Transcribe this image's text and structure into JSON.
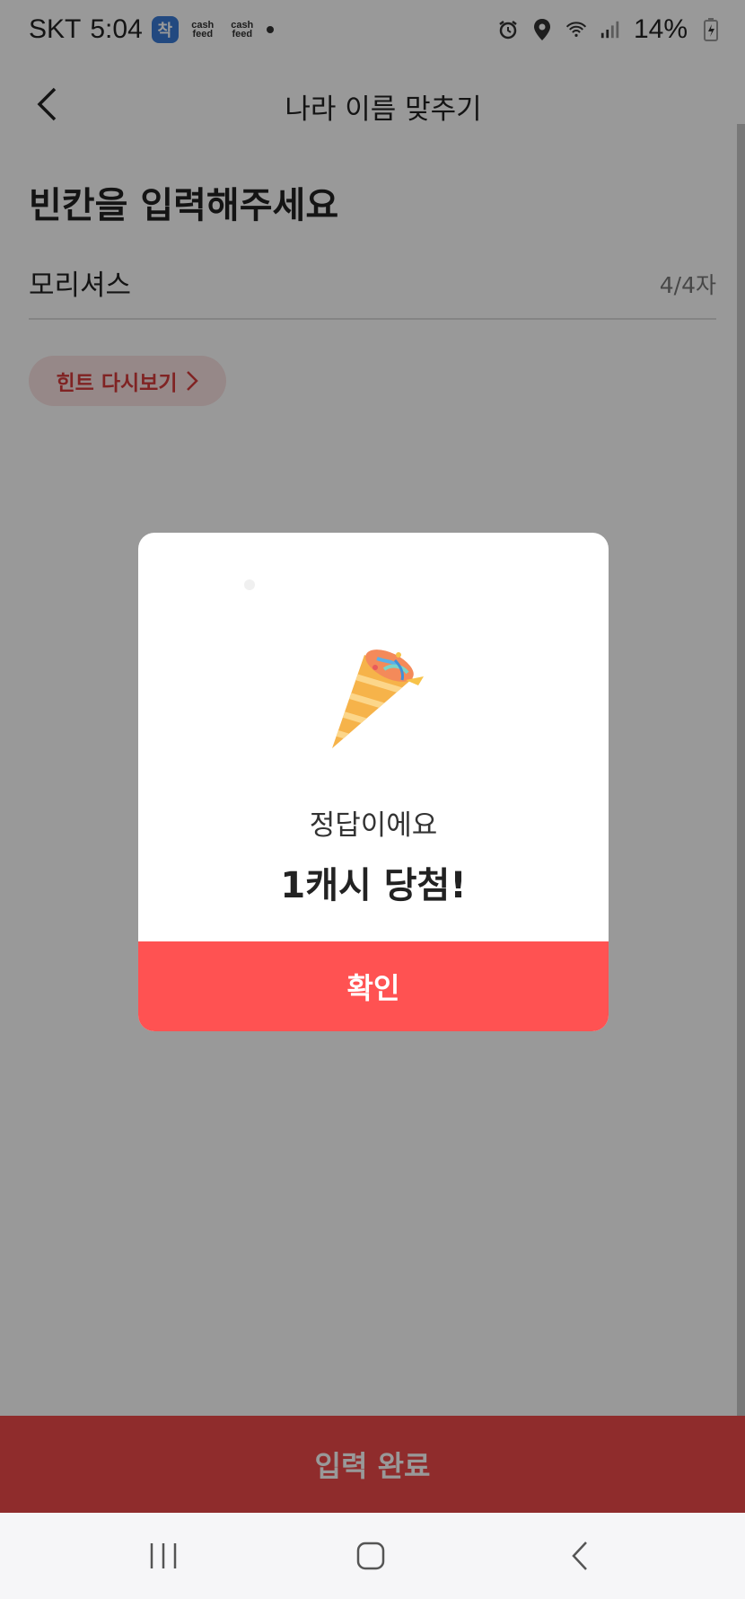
{
  "status_bar": {
    "carrier": "SKT",
    "time": "5:04",
    "app_badge": "착",
    "cashfeed1": "cash feed",
    "cashfeed2": "cash feed",
    "battery": "14%"
  },
  "header": {
    "title": "나라 이름 맞추기",
    "back_icon": "chevron-left-icon"
  },
  "main": {
    "title": "빈칸을 입력해주세요",
    "answer_value": "모리셔스",
    "answer_count": "4/4자",
    "hint_label": "힌트 다시보기"
  },
  "bottom": {
    "submit_label": "입력 완료"
  },
  "modal": {
    "sub_text": "정답이에요",
    "main_text": "1캐시 당첨!",
    "confirm_label": "확인",
    "icon": "party-popper-icon"
  },
  "colors": {
    "accent": "#ff5252",
    "hint_bg": "#fbe3e3",
    "hint_text": "#d63b3b"
  }
}
